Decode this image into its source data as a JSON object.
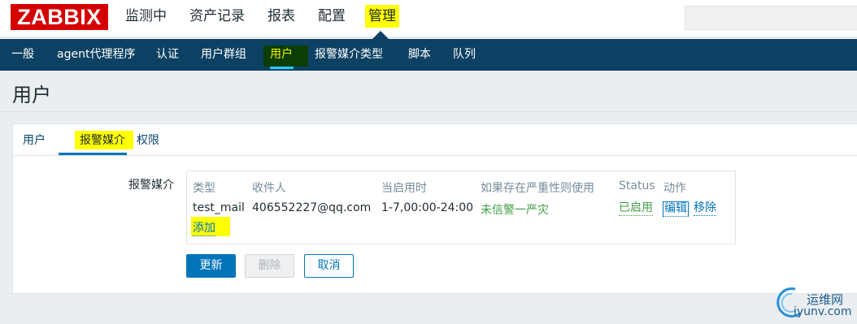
{
  "header": {
    "logo": "ZABBIX",
    "nav": [
      "监测中",
      "资产记录",
      "报表",
      "配置",
      "管理"
    ]
  },
  "subnav": {
    "items": [
      "一般",
      "agent代理程序",
      "认证",
      "用户群组",
      "用户",
      "报警媒介类型",
      "脚本",
      "队列"
    ]
  },
  "page": {
    "title": "用户"
  },
  "form": {
    "tabs": [
      "用户",
      "报警媒介",
      "权限"
    ],
    "field_label": "报警媒介",
    "media_table": {
      "headers": [
        "类型",
        "收件人",
        "当启用时",
        "如果存在严重性则使用",
        "Status",
        "动作"
      ],
      "row": {
        "type": "test_mail",
        "recipient": "406552227@qq.com",
        "when_active": "1-7,00:00-24:00",
        "severity": "未信警一严灾",
        "status": "已启用",
        "edit": "编辑",
        "remove": "移除"
      },
      "add_label": "添加"
    },
    "buttons": {
      "update": "更新",
      "delete": "删除",
      "cancel": "取消"
    }
  },
  "watermark": {
    "line1": "运维网",
    "line2": "iyunv.com"
  },
  "colors": {
    "logo": "#d40000",
    "subnav": "#0d4163",
    "primary": "#0275b8",
    "highlight": "#ffff00",
    "status_green": "#429e47"
  }
}
